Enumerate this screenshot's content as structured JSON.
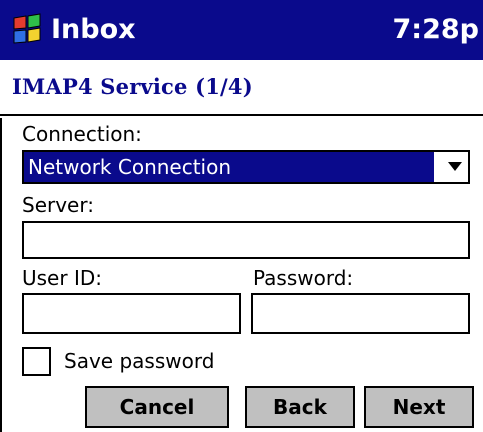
{
  "titlebar": {
    "app_name": "Inbox",
    "time": "7:28p",
    "logo_icon": "windows-flag-icon"
  },
  "subheader": {
    "title": "IMAP4 Service (1/4)"
  },
  "form": {
    "connection_label": "Connection:",
    "connection_selected": "Network Connection",
    "server_label": "Server:",
    "server_value": "",
    "userid_label": "User ID:",
    "userid_value": "",
    "password_label": "Password:",
    "password_value": "",
    "save_password_label": "Save password",
    "save_password_checked": false
  },
  "buttons": {
    "cancel": "Cancel",
    "back": "Back",
    "next": "Next"
  },
  "colors": {
    "titlebar_bg": "#0a0a8c",
    "selection_bg": "#0a0a8c",
    "button_bg": "#c0c0c0"
  }
}
